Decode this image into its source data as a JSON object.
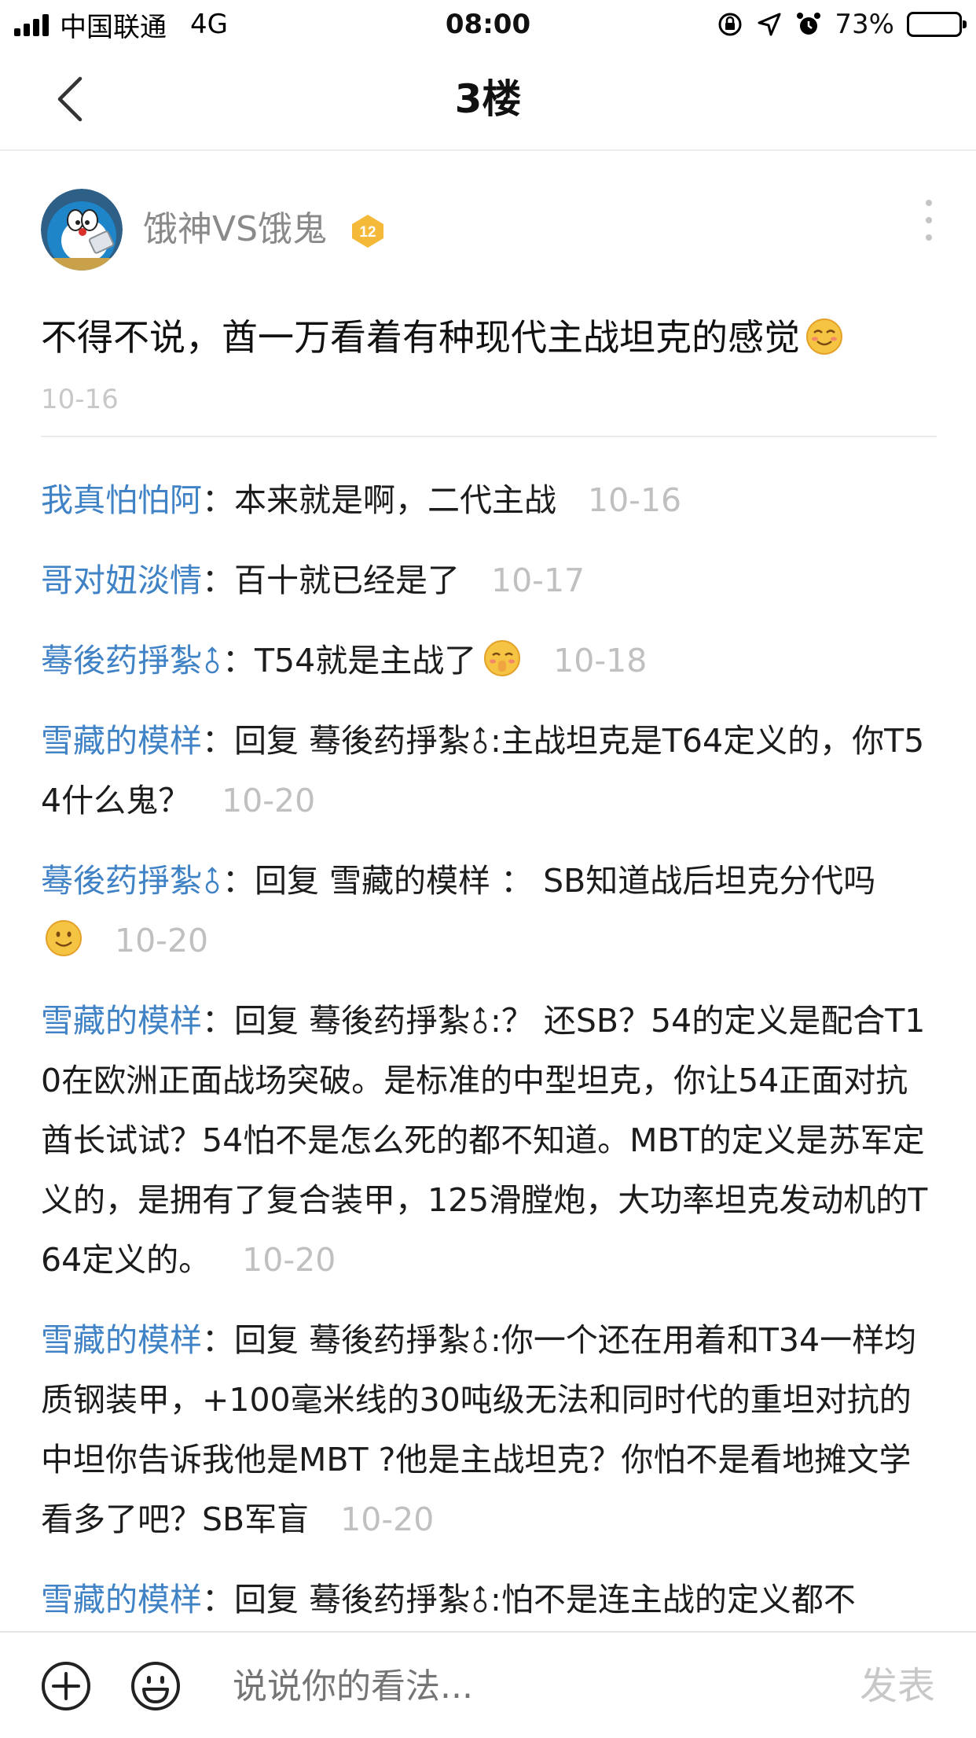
{
  "status_bar": {
    "carrier": "中国联通",
    "network": "4G",
    "time": "08:00",
    "battery": "73%",
    "battery_level": 0.73
  },
  "nav": {
    "title": "3楼"
  },
  "post": {
    "username": "饿神VS饿鬼",
    "level": "12",
    "content": "不得不说，酋一万看着有种现代主战坦克的感觉",
    "date": "10-16"
  },
  "replies": [
    {
      "user": "我真怕怕阿",
      "colon": "：",
      "text": "本来就是啊，二代主战",
      "date": "10-16"
    },
    {
      "user": "哥对妞淡情",
      "colon": "：",
      "text": "百十就已经是了",
      "date": "10-17"
    },
    {
      "user": "蓦後药掙紮",
      "colon": "：",
      "text": "T54就是主战了",
      "date": "10-18"
    },
    {
      "user": "雪藏的模样",
      "colon": "：",
      "text_a": "回复 蓦後药掙紮",
      "text_b": ":主战坦克是T64定义的，你T54什么鬼？",
      "date": "10-20"
    },
    {
      "user": "蓦後药掙紮",
      "colon": "：",
      "text": "回复 雪藏的模样 ： SB知道战后坦克分代吗",
      "date": "10-20"
    },
    {
      "user": "雪藏的模样",
      "colon": "：",
      "text_a": "回复 蓦後药掙紮",
      "text_b": ":？ 还SB？54的定义是配合T10在欧洲正面战场突破。是标准的中型坦克，你让54正面对抗酋长试试？54怕不是怎么死的都不知道。MBT的定义是苏军定义的，是拥有了复合装甲，125滑膛炮，大功率坦克发动机的T64定义的。",
      "date": "10-20"
    },
    {
      "user": "雪藏的模样",
      "colon": "：",
      "text_a": "回复 蓦後药掙紮",
      "text_b": ":你一个还在用着和T34一样均质钢装甲，+100毫米线的30吨级无法和同时代的重坦对抗的中坦你告诉我他是MBT ?他是主战坦克？你怕不是看地摊文学看多了吧？SB军盲",
      "date": "10-20"
    },
    {
      "user": "雪藏的模样",
      "colon": "：",
      "text_a": "回复 蓦後药掙紮",
      "text_b": ":怕不是连主战的定义都不"
    }
  ],
  "bottom_bar": {
    "placeholder": "说说你的看法...",
    "send_label": "发表"
  },
  "colors": {
    "link_blue": "#3f82c5",
    "date_gray": "#c0c0c0",
    "level_badge": "#f5b93a"
  }
}
